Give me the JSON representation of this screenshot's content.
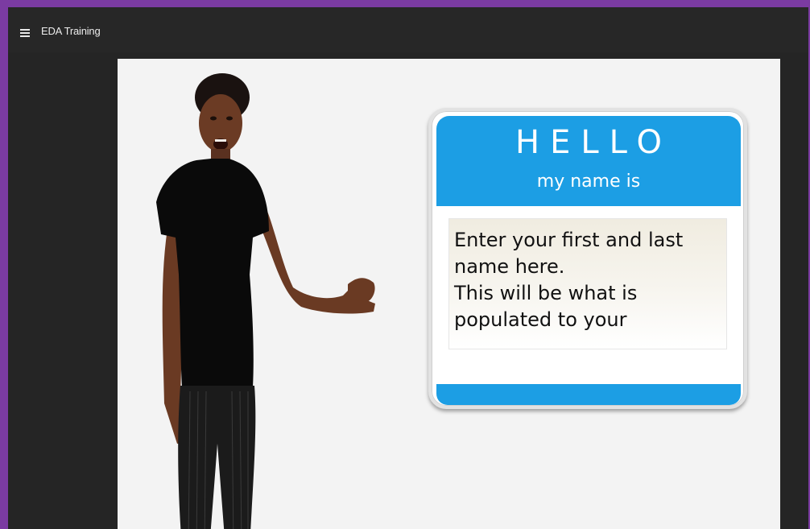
{
  "app": {
    "title": "EDA Training",
    "menu_icon": "hamburger-menu-icon"
  },
  "slide": {
    "name_tag": {
      "hello": "HELLO",
      "subtitle": "my name is",
      "input_text": "Enter your first and last name here.\nThis will be what is populated to your"
    }
  },
  "colors": {
    "frame": "#7b3ba2",
    "app_background": "#252525",
    "stage_background": "#f3f3f3",
    "tag_blue": "#1c9ee4"
  }
}
